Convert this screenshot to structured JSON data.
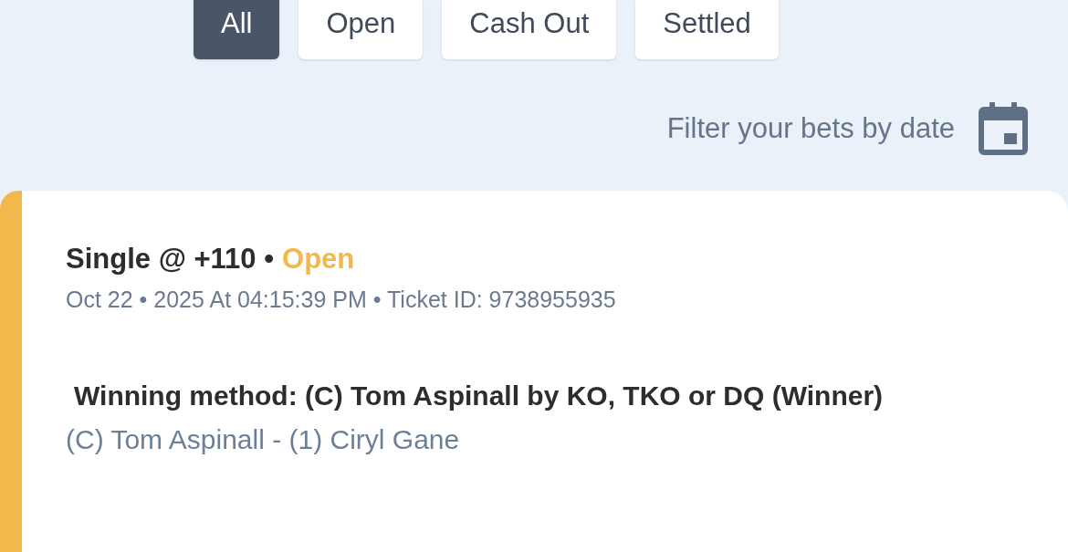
{
  "tabs": [
    {
      "label": "All",
      "selected": true
    },
    {
      "label": "Open",
      "selected": false
    },
    {
      "label": "Cash Out",
      "selected": false
    },
    {
      "label": "Settled",
      "selected": false
    }
  ],
  "date_filter": {
    "label": "Filter your bets by date"
  },
  "bet": {
    "title": "Single @ +110 •",
    "status": {
      "label": "Open",
      "kind": "open"
    },
    "meta": "Oct 22 • 2025 At 04:15:39 PM • Ticket ID: 9738955935",
    "selection": "Winning method: (C) Tom Aspinall by KO, TKO or DQ (Winner)",
    "event": "(C) Tom Aspinall - (1) Ciryl Gane"
  }
}
